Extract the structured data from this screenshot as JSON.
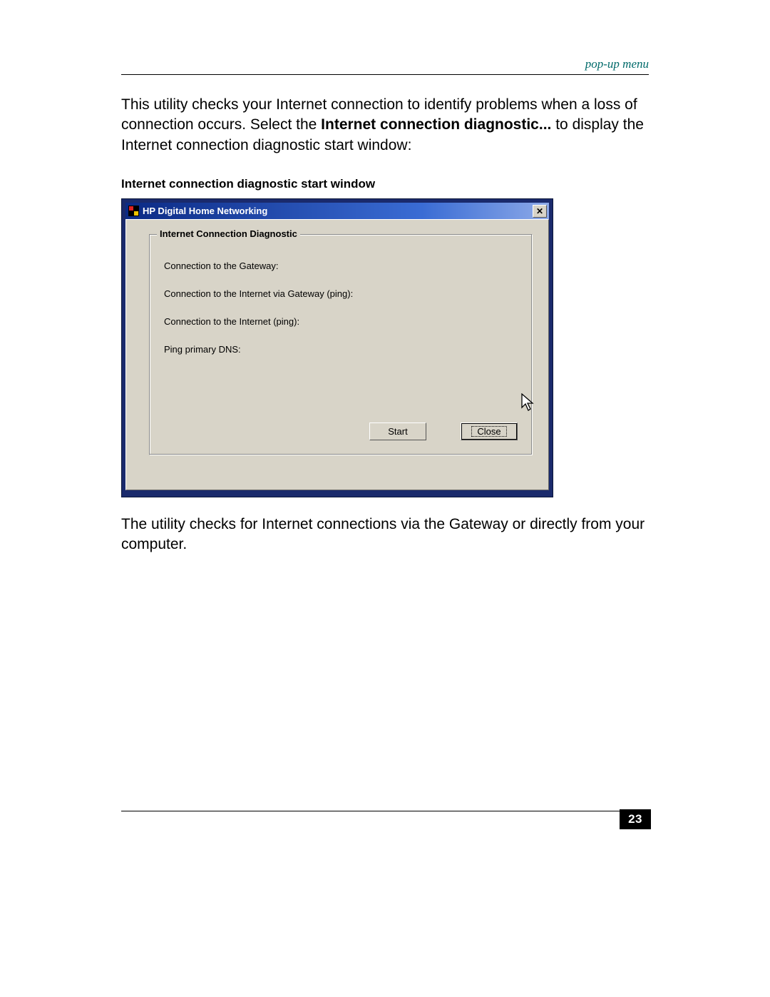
{
  "header_label": "pop-up menu",
  "intro": {
    "pre": "This utility checks your Internet connection to identify problems when a loss of connection occurs. Select the ",
    "bold": "Internet connection diagnostic...",
    "post": " to display the Internet connection diagnostic start window:"
  },
  "caption": "Internet connection diagnostic start window",
  "dialog": {
    "title": "HP Digital Home Networking",
    "close_glyph": "✕",
    "group_legend": "Internet Connection Diagnostic",
    "lines": [
      "Connection to the  Gateway:",
      "Connection to the Internet via Gateway (ping):",
      "Connection to the Internet (ping):",
      "Ping primary DNS:"
    ],
    "start_label": "Start",
    "close_label": "Close"
  },
  "outro": "The utility checks for Internet connections via the Gateway or directly from your computer.",
  "page_number": "23"
}
